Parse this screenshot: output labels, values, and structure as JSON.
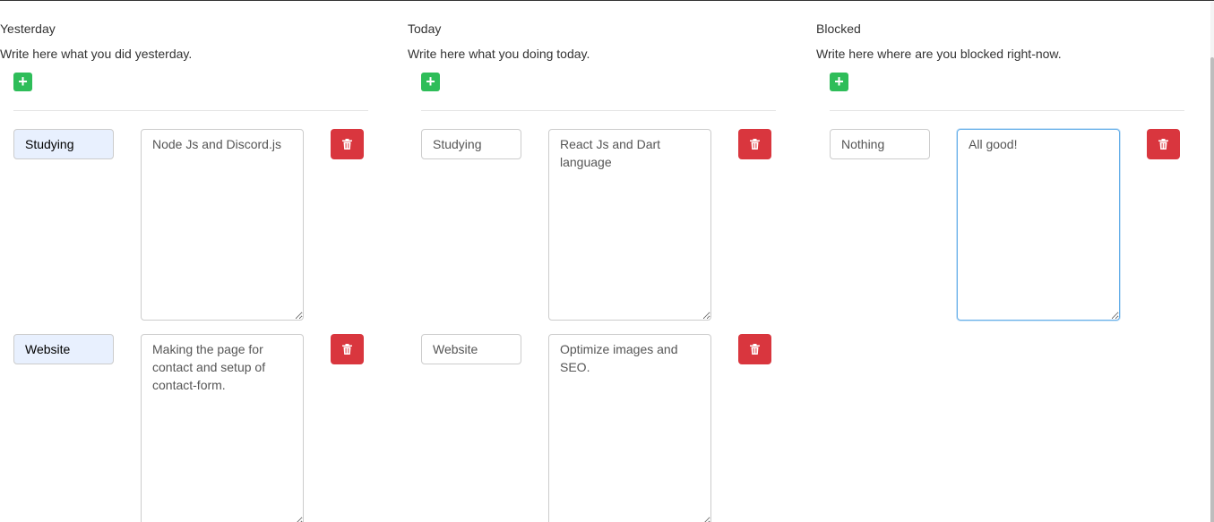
{
  "columns": [
    {
      "title": "Yesterday",
      "description": "Write here what you did yesterday.",
      "add_icon": "plus-icon",
      "entries": [
        {
          "title": "Studying",
          "text": "Node Js and Discord.js",
          "title_autofilled": true,
          "focused": false
        },
        {
          "title": "Website",
          "text": "Making the page for contact and setup of contact-form.",
          "title_autofilled": true,
          "focused": false
        }
      ]
    },
    {
      "title": "Today",
      "description": "Write here what you doing today.",
      "add_icon": "plus-icon",
      "entries": [
        {
          "title": "Studying",
          "text": "React Js and Dart language",
          "title_autofilled": false,
          "focused": false
        },
        {
          "title": "Website",
          "text": "Optimize images and SEO.",
          "title_autofilled": false,
          "focused": false
        }
      ]
    },
    {
      "title": "Blocked",
      "description": "Write here where are you blocked right-now.",
      "add_icon": "plus-icon",
      "entries": [
        {
          "title": "Nothing",
          "text": "All good!",
          "title_autofilled": false,
          "focused": true
        }
      ]
    }
  ],
  "icons": {
    "add": "plus-icon",
    "delete": "trash-icon"
  },
  "colors": {
    "add_button": "#2ebd59",
    "delete_button": "#d9363e",
    "autofill_background": "#e8f0fe",
    "focus_border": "#66afe9"
  }
}
